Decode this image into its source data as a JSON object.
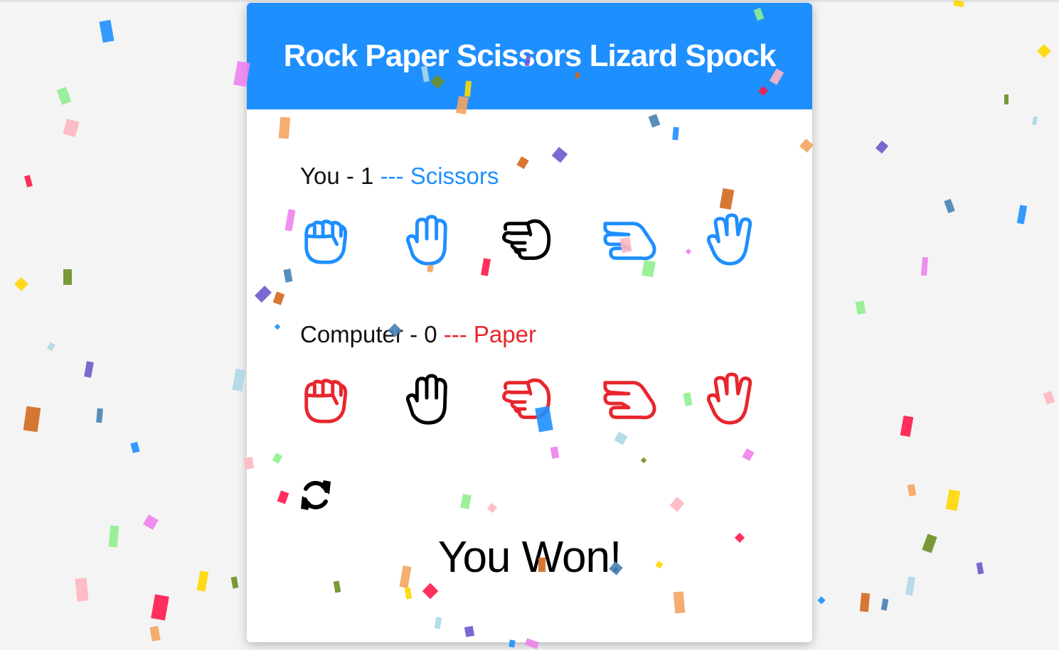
{
  "app": {
    "title": "Rock Paper Scissors Lizard Spock",
    "accent_color": "#1e8fff",
    "computer_color": "#e8262d"
  },
  "player": {
    "label": "You",
    "separator": "-",
    "score": "1",
    "dashes": "---",
    "choice": "Scissors",
    "selected_index": 2
  },
  "computer": {
    "label": "Computer",
    "separator": "-",
    "score": "0",
    "dashes": "---",
    "choice": "Paper",
    "selected_index": 1
  },
  "hands": [
    {
      "name": "rock",
      "icon": "hand-rock-icon"
    },
    {
      "name": "paper",
      "icon": "hand-paper-icon"
    },
    {
      "name": "scissors",
      "icon": "hand-scissors-icon"
    },
    {
      "name": "lizard",
      "icon": "hand-lizard-icon"
    },
    {
      "name": "spock",
      "icon": "hand-spock-icon"
    }
  ],
  "reset": {
    "icon": "refresh-icon"
  },
  "result": {
    "text": "You Won!"
  },
  "confetti_colors": [
    "#1e8fff",
    "#ee82ee",
    "#90ee90",
    "#ffb6c1",
    "#ff1a4b",
    "#f4a460",
    "#ffd700",
    "#6b8e23",
    "#add8e6",
    "#6a5acd",
    "#d2691e",
    "#4682b4"
  ]
}
